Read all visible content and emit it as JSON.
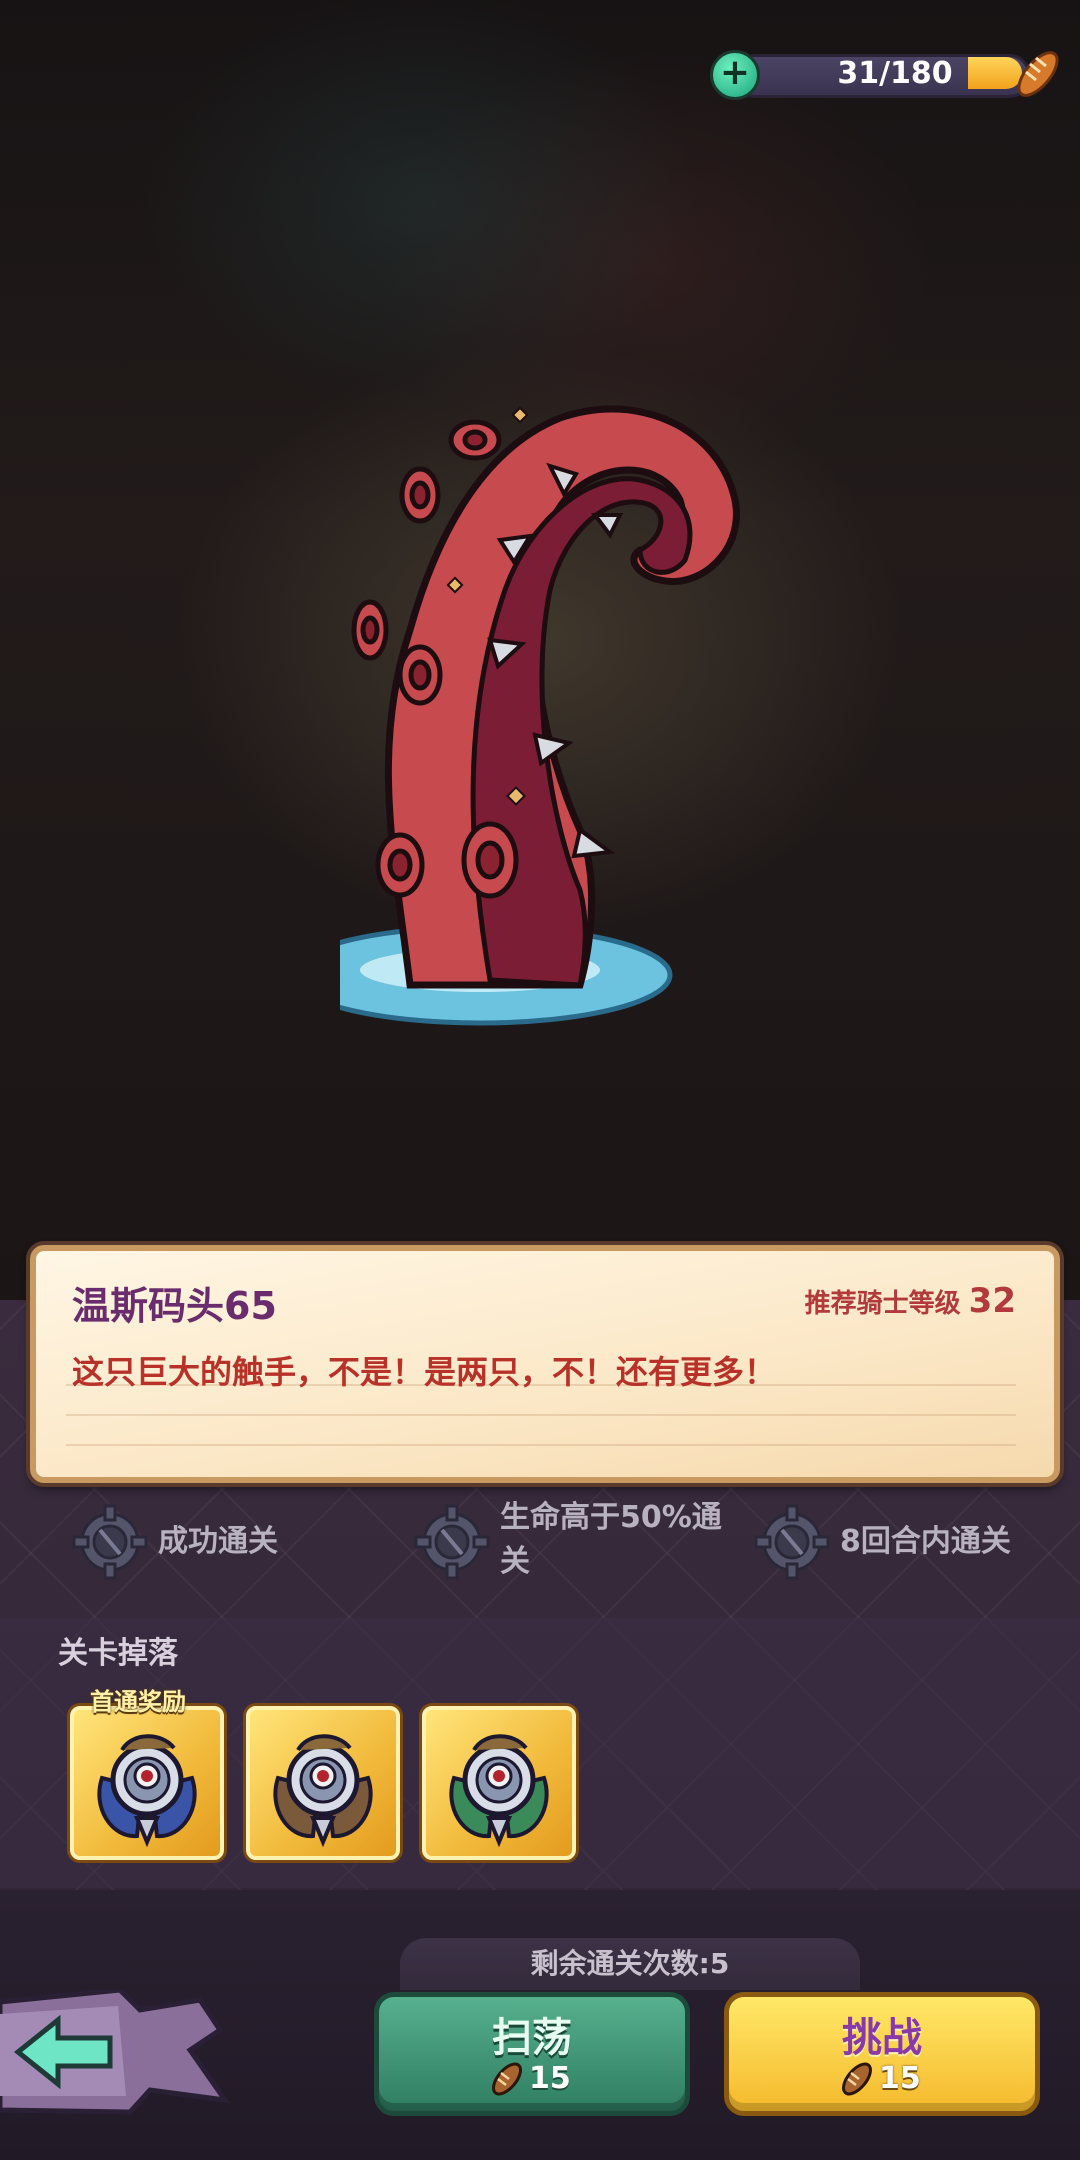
{
  "energy": {
    "current_max": "31/180",
    "level": 0.17
  },
  "stage": {
    "name": "温斯码头65",
    "recommend_label": "推荐骑士等级",
    "recommend_level": "32",
    "description": "这只巨大的触手，不是！是两只，不！还有更多！"
  },
  "objectives": [
    {
      "text": "成功通关"
    },
    {
      "text_line1": "生命高于50%通",
      "text_line2": "关"
    },
    {
      "text": "8回合内通关"
    }
  ],
  "drops": {
    "title": "关卡掉落",
    "first_clear_tag": "首通奖励",
    "items": [
      {
        "icon": "knight-armor-icon",
        "accent": "#3a55a8"
      },
      {
        "icon": "knight-armor-icon",
        "accent": "#7a5a3a"
      },
      {
        "icon": "knight-armor-icon",
        "accent": "#3a8a5a"
      }
    ]
  },
  "remaining": "剩余通关次数:5",
  "buttons": {
    "sweep": {
      "label": "扫荡",
      "cost": "15"
    },
    "challenge": {
      "label": "挑战",
      "cost": "15"
    }
  },
  "colors": {
    "sweep": "#3e9a78",
    "challenge": "#f7c93a",
    "title": "#6a2c6c",
    "desc": "#b8322a"
  }
}
